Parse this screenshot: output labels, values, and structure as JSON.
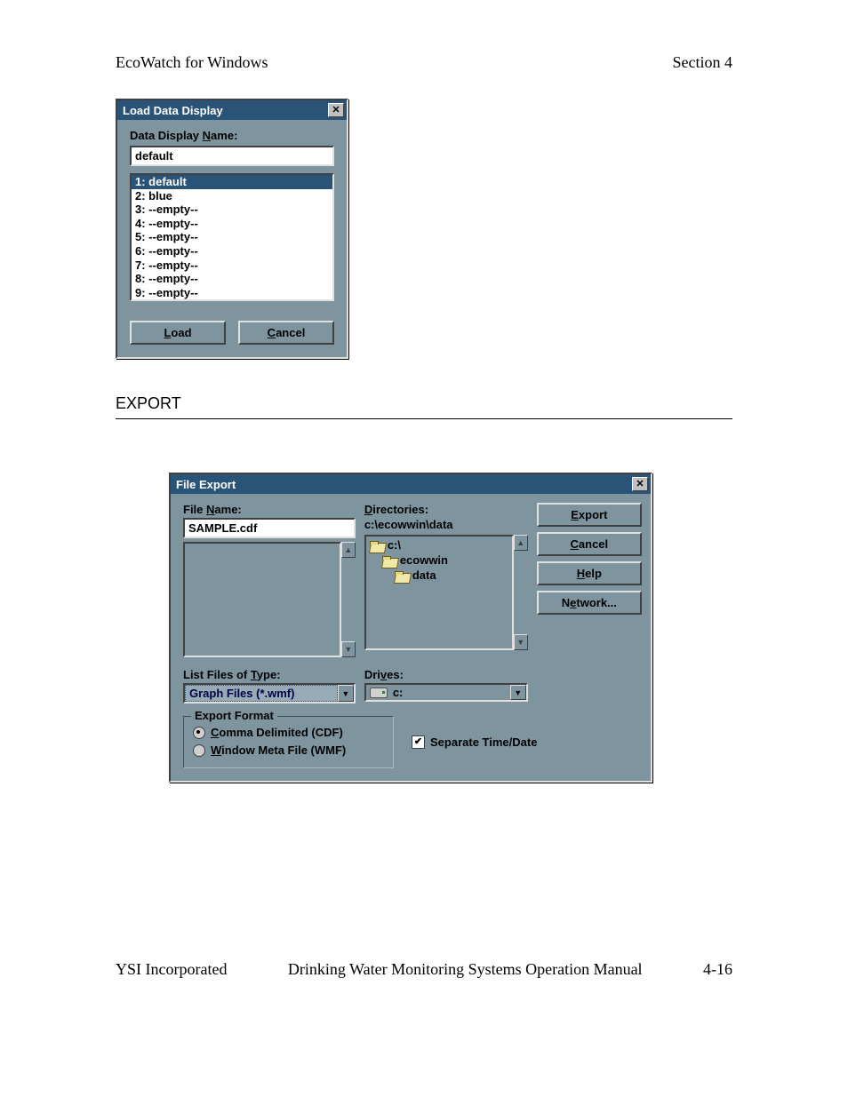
{
  "page": {
    "header_left": "EcoWatch for Windows",
    "header_right": "Section 4",
    "section_heading": "EXPORT",
    "footer_left": "YSI Incorporated",
    "footer_mid": "Drinking Water Monitoring Systems Operation Manual",
    "footer_right": "4-16"
  },
  "load_dialog": {
    "title": "Load Data Display",
    "name_label_pre": "Data Display ",
    "name_label_u": "N",
    "name_label_post": "ame:",
    "name_value": "default",
    "items": [
      "1:  default",
      "2:  blue",
      "3:  --empty--",
      "4:  --empty--",
      "5:  --empty--",
      "6:  --empty--",
      "7:  --empty--",
      "8:  --empty--",
      "9:  --empty--"
    ],
    "selected_index": 0,
    "load_u": "L",
    "load_rest": "oad",
    "cancel_u": "C",
    "cancel_rest": "ancel"
  },
  "export_dialog": {
    "title": "File Export",
    "filename_label_pre": "File ",
    "filename_label_u": "N",
    "filename_label_post": "ame:",
    "filename_value": "SAMPLE.cdf",
    "dir_label_u": "D",
    "dir_label_rest": "irectories:",
    "dir_path": "c:\\ecowwin\\data",
    "tree": {
      "root": "c:\\",
      "child1": "ecowwin",
      "child2": "data"
    },
    "listtype_label_pre": "List Files of ",
    "listtype_label_u": "T",
    "listtype_label_post": "ype:",
    "listtype_value": "Graph Files (*.wmf)",
    "drives_label_pre": "Dri",
    "drives_label_u": "v",
    "drives_label_post": "es:",
    "drives_value": "c:",
    "btn_export_u": "E",
    "btn_export_rest": "xport",
    "btn_cancel_u": "C",
    "btn_cancel_rest": "ancel",
    "btn_help_u": "H",
    "btn_help_rest": "elp",
    "btn_network_pre": "N",
    "btn_network_u": "e",
    "btn_network_post": "twork...",
    "group_legend": "Export Format",
    "radio1_u": "C",
    "radio1_rest": "omma Delimited (CDF)",
    "radio2_u": "W",
    "radio2_rest": "indow Meta File (WMF)",
    "radio_selected": "cdf",
    "check_label": "Separate Time/Date",
    "check_on": true
  }
}
